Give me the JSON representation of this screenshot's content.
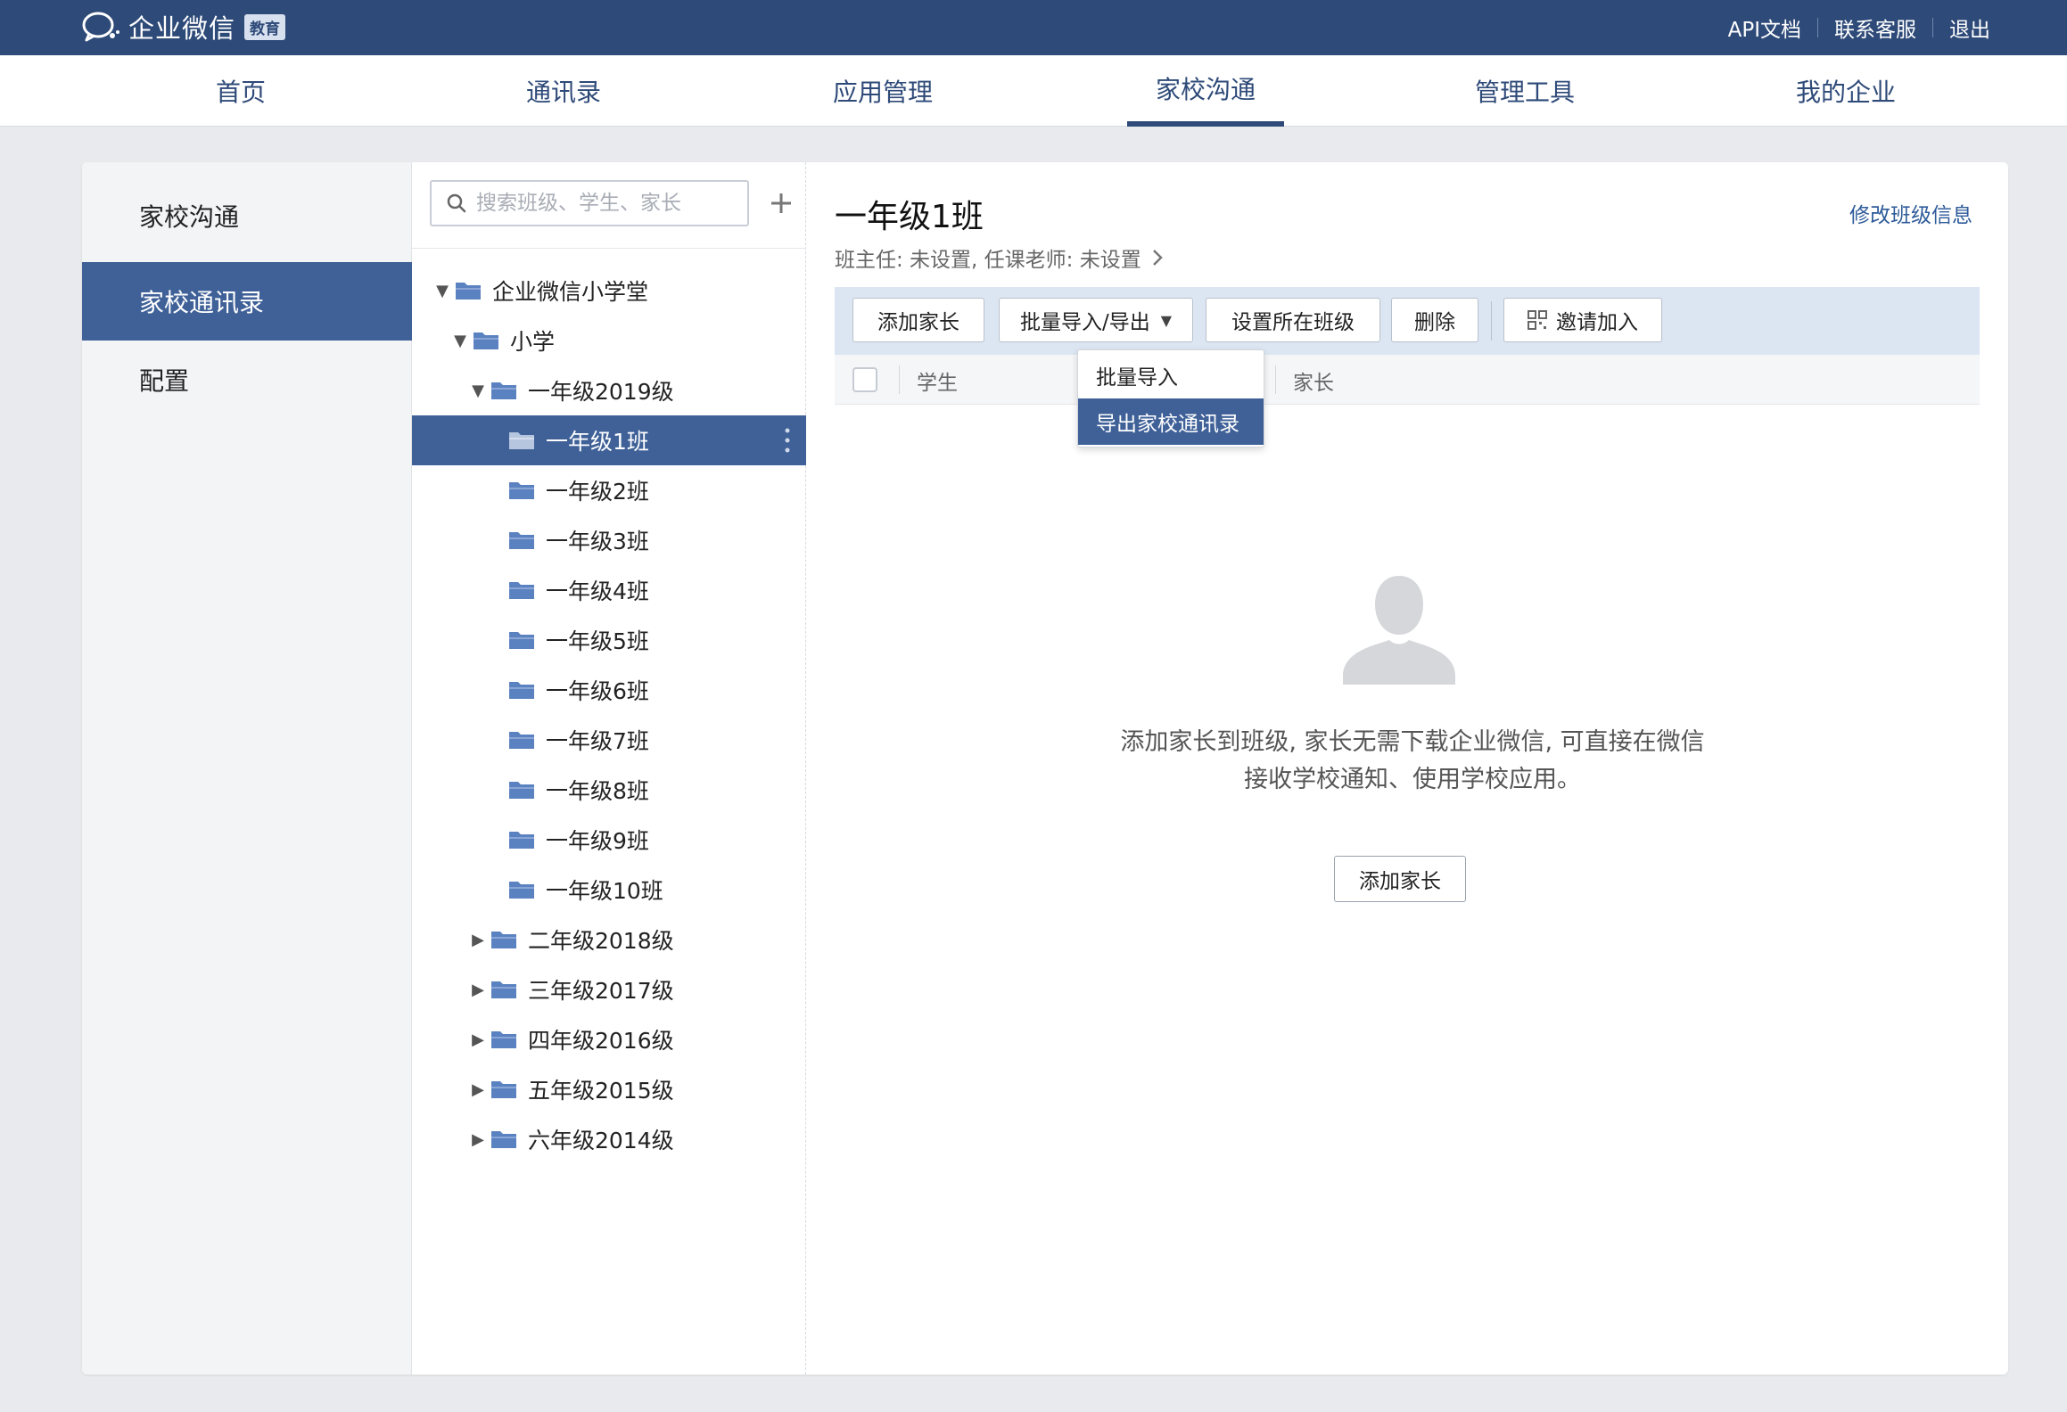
{
  "topbar": {
    "brand_name": "企业微信",
    "brand_badge": "教育",
    "links": [
      "API文档",
      "联系客服",
      "退出"
    ]
  },
  "nav": {
    "tabs": [
      "首页",
      "通讯录",
      "应用管理",
      "家校沟通",
      "管理工具",
      "我的企业"
    ],
    "active": "家校沟通"
  },
  "sidebar": {
    "items": [
      "家校沟通",
      "家校通讯录",
      "配置"
    ],
    "active": "家校通讯录"
  },
  "tree": {
    "search_placeholder": "搜索班级、学生、家长",
    "nodes": [
      {
        "label": "企业微信小学堂",
        "level": 0,
        "expanded": true
      },
      {
        "label": "小学",
        "level": 1,
        "expanded": true
      },
      {
        "label": "一年级2019级",
        "level": 2,
        "expanded": true
      },
      {
        "label": "一年级1班",
        "level": 3,
        "selected": true
      },
      {
        "label": "一年级2班",
        "level": 3
      },
      {
        "label": "一年级3班",
        "level": 3
      },
      {
        "label": "一年级4班",
        "level": 3
      },
      {
        "label": "一年级5班",
        "level": 3
      },
      {
        "label": "一年级6班",
        "level": 3
      },
      {
        "label": "一年级7班",
        "level": 3
      },
      {
        "label": "一年级8班",
        "level": 3
      },
      {
        "label": "一年级9班",
        "level": 3
      },
      {
        "label": "一年级10班",
        "level": 3
      },
      {
        "label": "二年级2018级",
        "level": 2,
        "expanded": false
      },
      {
        "label": "三年级2017级",
        "level": 2,
        "expanded": false
      },
      {
        "label": "四年级2016级",
        "level": 2,
        "expanded": false
      },
      {
        "label": "五年级2015级",
        "level": 2,
        "expanded": false
      },
      {
        "label": "六年级2014级",
        "level": 2,
        "expanded": false
      }
    ]
  },
  "detail": {
    "class_title": "一年级1班",
    "edit_link": "修改班级信息",
    "subtitle": "班主任: 未设置,  任课老师: 未设置",
    "toolbar": {
      "add_parent": "添加家长",
      "bulk": "批量导入/导出",
      "set_class": "设置所在班级",
      "delete": "删除",
      "invite": "邀请加入"
    },
    "dropdown": [
      "批量导入",
      "导出家校通讯录"
    ],
    "dropdown_active": "导出家校通讯录",
    "columns": [
      "学生",
      "家长"
    ],
    "empty_line1": "添加家长到班级, 家长无需下载企业微信, 可直接在微信",
    "empty_line2": "接收学校通知、使用学校应用。",
    "empty_button": "添加家长"
  },
  "colors": {
    "topbar": "#2e4a78",
    "accent": "#3f6198",
    "toolbar_bg": "#dce6f2",
    "folder": "#5b82c0"
  }
}
